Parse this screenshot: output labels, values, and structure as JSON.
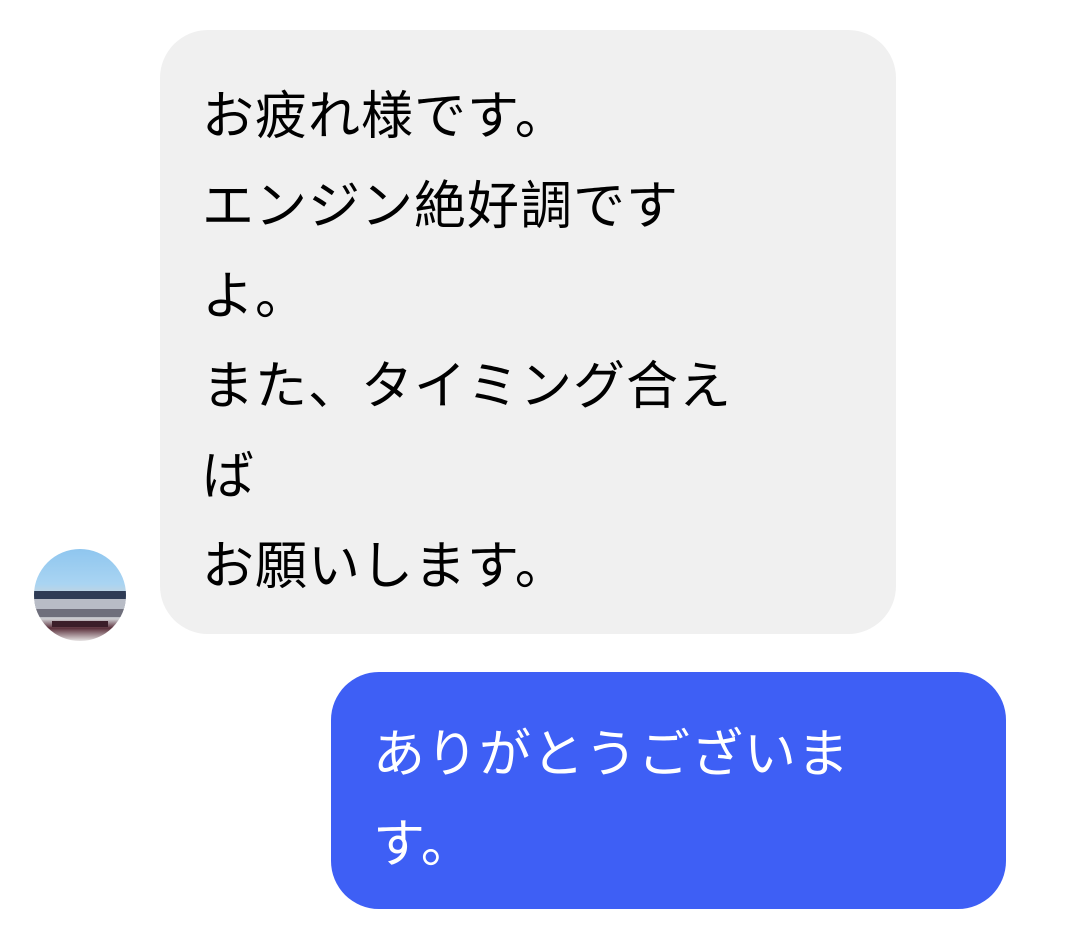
{
  "incoming_message": {
    "lines": [
      "お疲れ様です。",
      "エンジン絶好調です",
      "よ。",
      "また、タイミング合え",
      "ば",
      "お願いします。"
    ]
  },
  "outgoing_message": {
    "lines": [
      "ありがとうございま",
      "す。"
    ]
  },
  "colors": {
    "incoming_bubble": "#f0f0f0",
    "outgoing_bubble": "#3e5ff5",
    "incoming_text": "#000000",
    "outgoing_text": "#ffffff"
  }
}
